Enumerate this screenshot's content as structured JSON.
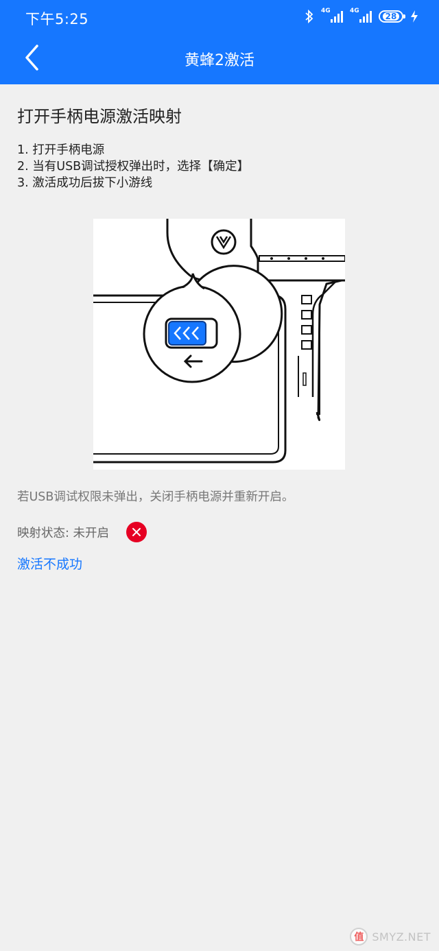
{
  "status_bar": {
    "time": "下午5:25",
    "signal1_label": "4G",
    "signal2_label": "4G",
    "battery": "28",
    "icons": [
      "bluetooth-icon",
      "signal-icon",
      "signal-icon",
      "battery-icon",
      "charging-icon"
    ]
  },
  "app_bar": {
    "title": "黄蜂2激活",
    "back_icon": "back-arrow-icon"
  },
  "content": {
    "heading": "打开手柄电源激活映射",
    "steps": [
      "1. 打开手柄电源",
      "2. 当有USB调试授权弹出时，选择【确定】",
      "3. 激活成功后拔下小游线"
    ],
    "hint": "若USB调试权限未弹出，关闭手柄电源并重新开启。",
    "status_label": "映射状态: 未开启",
    "status_icon": "error-x-icon",
    "link": "激活不成功"
  },
  "watermark": {
    "logo": "值",
    "text": "SMYZ.NET"
  },
  "colors": {
    "primary": "#1677ff",
    "error": "#e60023",
    "background": "#f0f0f0"
  }
}
